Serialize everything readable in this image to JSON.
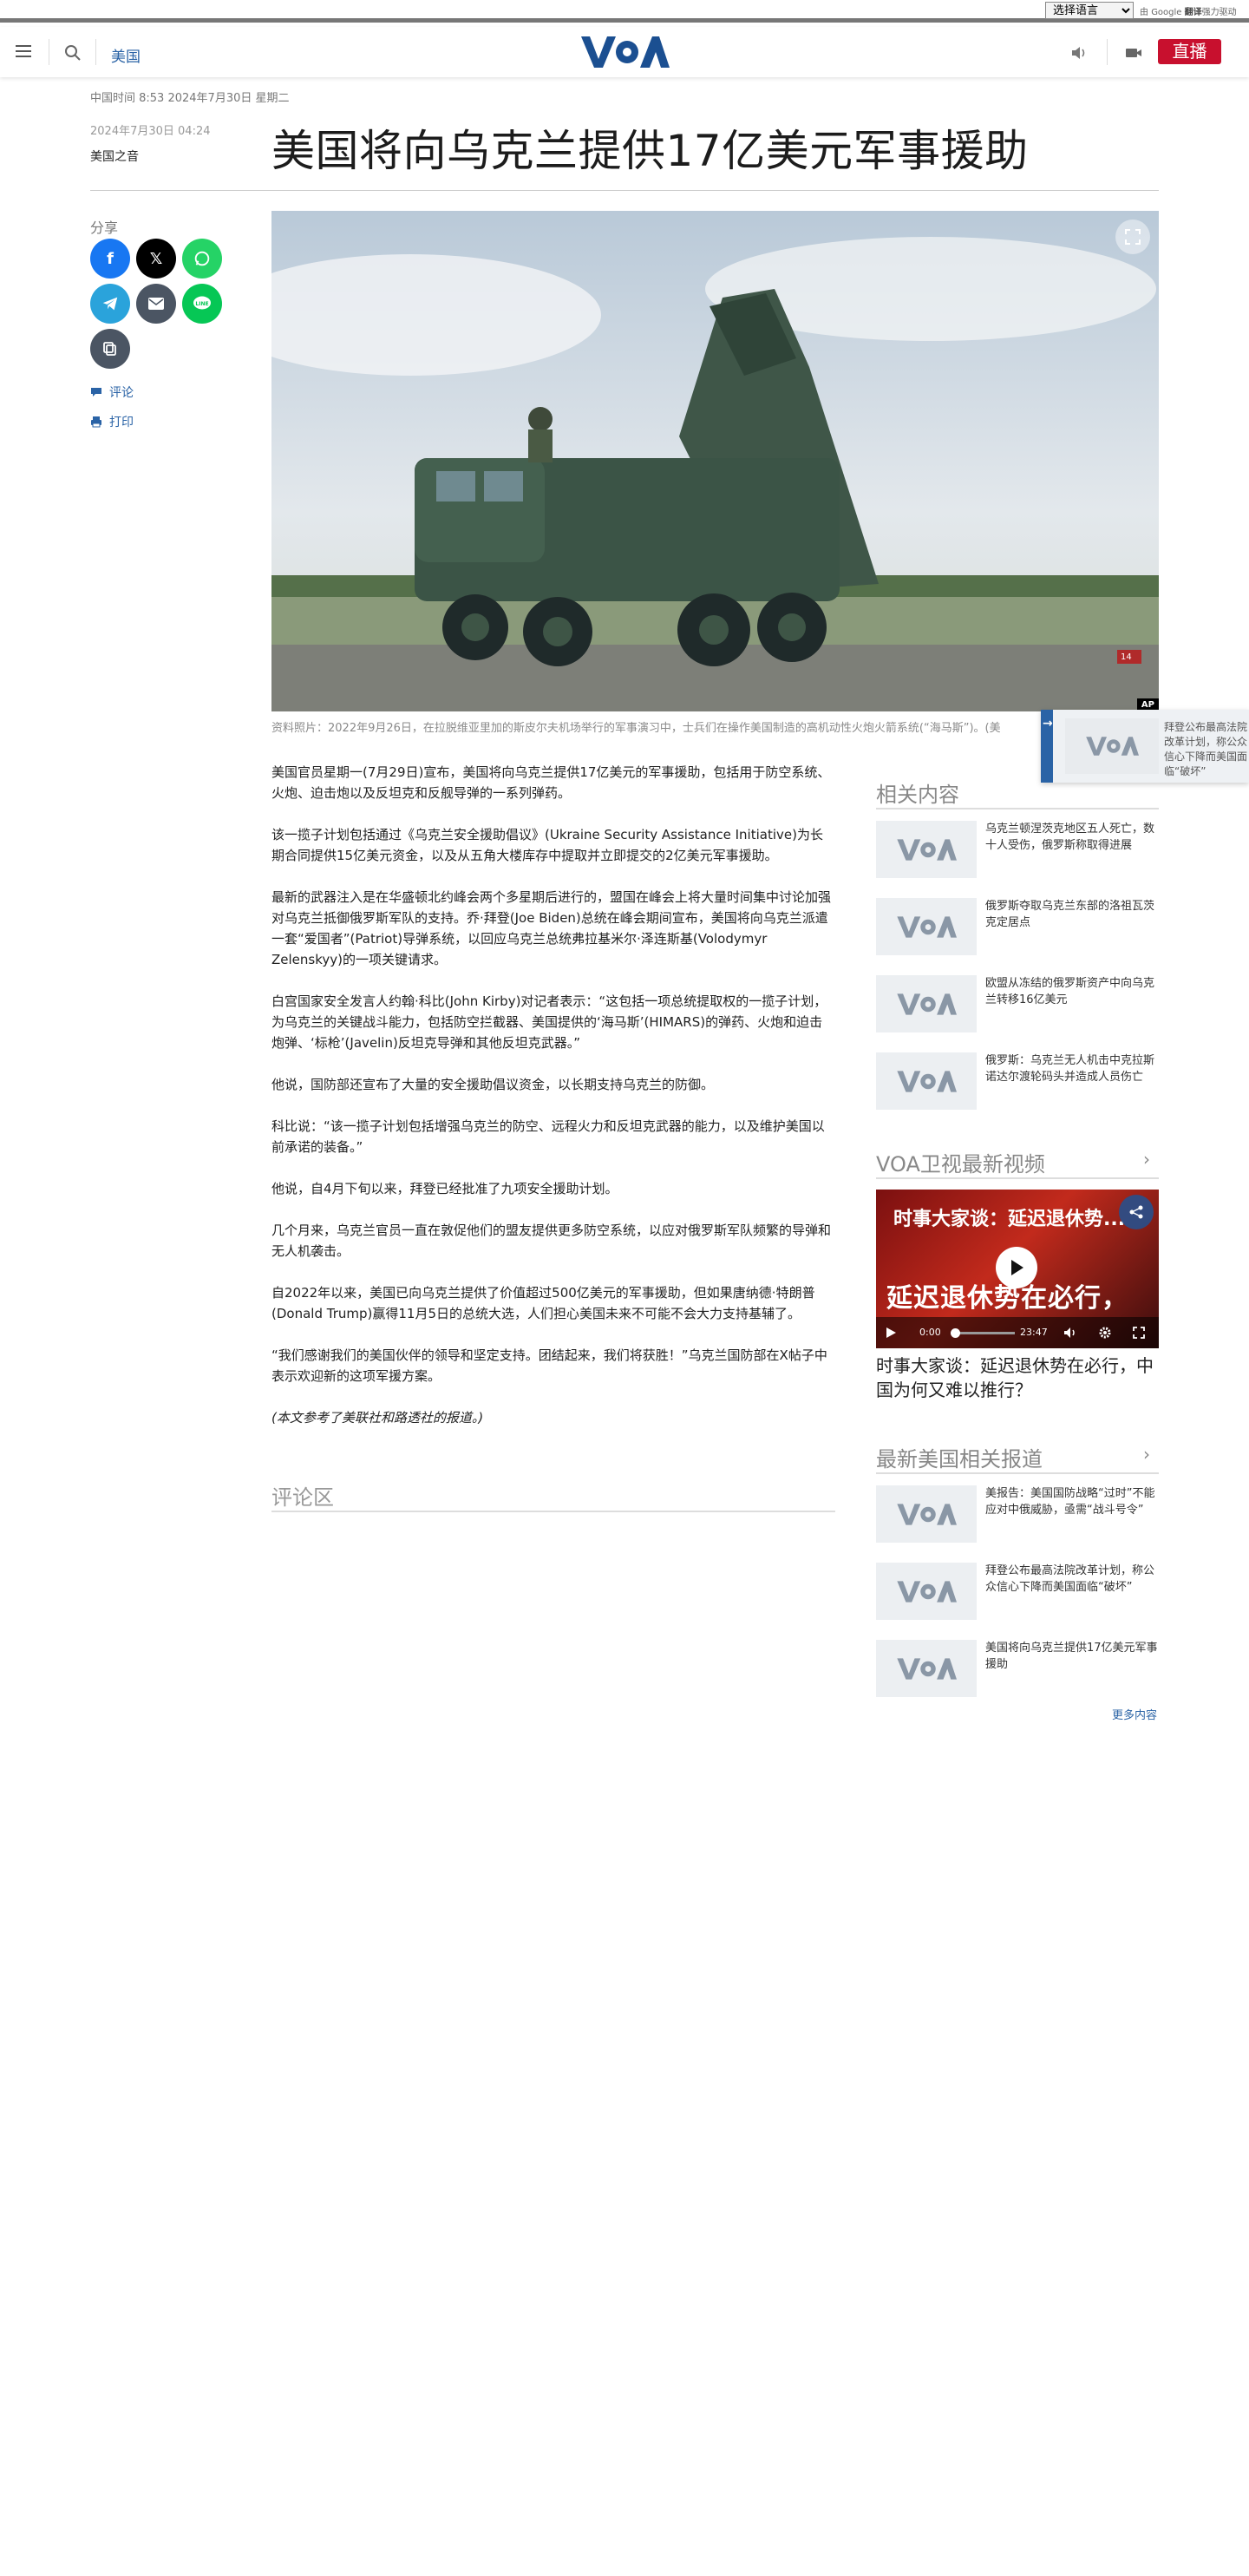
{
  "translate": {
    "select_value": "选择语言",
    "powered": "由",
    "google": "Google",
    "bold": "翻译",
    "suffix": "强力驱动"
  },
  "header": {
    "section": "美国",
    "live": "直播",
    "logo_text": "VOA"
  },
  "article": {
    "timestamp": "中国时间 8:53 2024年7月30日 星期二",
    "pubdate": "2024年7月30日 04:24",
    "author": "美国之音",
    "title": "美国将向乌克兰提供17亿美元军事援助",
    "caption": "资料照片：2022年9月26日，在拉脱维亚里加的斯皮尔夫机场举行的军事演习中，士兵们在操作美国制造的高机动性火炮火箭系统(“海马斯”)。(美",
    "image_badge": "AP",
    "image_plate": "14",
    "paragraphs": [
      "美国官员星期一(7月29日)宣布，美国将向乌克兰提供17亿美元的军事援助，包括用于防空系统、火炮、迫击炮以及反坦克和反舰导弹的一系列弹药。",
      "该一揽子计划包括通过《乌克兰安全援助倡议》(Ukraine Security Assistance Initiative)为长期合同提供15亿美元资金，以及从五角大楼库存中提取并立即提交的2亿美元军事援助。",
      "最新的武器注入是在华盛顿北约峰会两个多星期后进行的，盟国在峰会上将大量时间集中讨论加强对乌克兰抵御俄罗斯军队的支持。乔·拜登(Joe Biden)总统在峰会期间宣布，美国将向乌克兰派遣一套“爱国者”(Patriot)导弹系统，以回应乌克兰总统弗拉基米尔·泽连斯基(Volodymyr Zelenskyy)的一项关键请求。",
      "白宫国家安全发言人约翰·科比(John Kirby)对记者表示：“这包括一项总统提取权的一揽子计划，为乌克兰的关键战斗能力，包括防空拦截器、美国提供的‘海马斯’(HIMARS)的弹药、火炮和迫击炮弹、‘标枪’(Javelin)反坦克导弹和其他反坦克武器。”",
      "他说，国防部还宣布了大量的安全援助倡议资金，以长期支持乌克兰的防御。",
      "科比说：“该一揽子计划包括增强乌克兰的防空、远程火力和反坦克武器的能力，以及维护美国以前承诺的装备。”",
      "他说，自4月下旬以来，拜登已经批准了九项安全援助计划。",
      "几个月来，乌克兰官员一直在敦促他们的盟友提供更多防空系统，以应对俄罗斯军队频繁的导弹和无人机袭击。",
      "自2022年以来，美国已向乌克兰提供了价值超过500亿美元的军事援助，但如果唐纳德·特朗普(Donald Trump)赢得11月5日的总统大选，人们担心美国未来不可能不会大力支持基辅了。",
      "“我们感谢我们的美国伙伴的领导和坚定支持。团结起来，我们将获胜！”乌克兰国防部在X帖子中表示欢迎新的这项军援方案。"
    ],
    "note": "(本文参考了美联社和路透社的报道。)",
    "comments_heading": "评论区"
  },
  "share": {
    "label": "分享",
    "comment": "评论",
    "print": "打印"
  },
  "floating": {
    "text": "拜登公布最高法院改革计划，称公众信心下降而美国面临“破坏”"
  },
  "related": {
    "heading": "相关内容",
    "items": [
      {
        "text": "乌克兰顿涅茨克地区五人死亡，数十人受伤，俄罗斯称取得进展"
      },
      {
        "text": "俄罗斯夺取乌克兰东部的洛祖瓦茨克定居点"
      },
      {
        "text": "欧盟从冻结的俄罗斯资产中向乌克兰转移16亿美元"
      },
      {
        "text": "俄罗斯：乌克兰无人机击中克拉斯诺达尔渡轮码头并造成人员伤亡"
      }
    ]
  },
  "videos": {
    "heading": "VOA卫视最新视频",
    "video_title": "时事大家谈：延迟退休势...",
    "video_overlay": "延迟退休势在必行，",
    "time_current": "0:00",
    "time_total": "23:47",
    "caption": "时事大家谈：延迟退休势在必行，中国为何又难以推行？"
  },
  "latest": {
    "heading": "最新美国相关报道",
    "items": [
      {
        "text": "美报告：美国国防战略“过时”不能应对中俄威胁，亟需“战斗号令”"
      },
      {
        "text": "拜登公布最高法院改革计划，称公众信心下降而美国面临“破坏”"
      },
      {
        "text": "美国将向乌克兰提供17亿美元军事援助"
      }
    ],
    "more": "更多内容"
  },
  "colors": {
    "brand_blue": "#2a63a6",
    "live_red": "#c8102e"
  },
  "icons": [
    "menu-icon",
    "search-icon",
    "speaker-icon",
    "video-camera-icon",
    "facebook-icon",
    "x-icon",
    "whatsapp-icon",
    "telegram-icon",
    "email-icon",
    "line-icon",
    "copy-icon",
    "comment-icon",
    "print-icon",
    "fullscreen-icon",
    "play-icon",
    "chevron-right-icon"
  ]
}
